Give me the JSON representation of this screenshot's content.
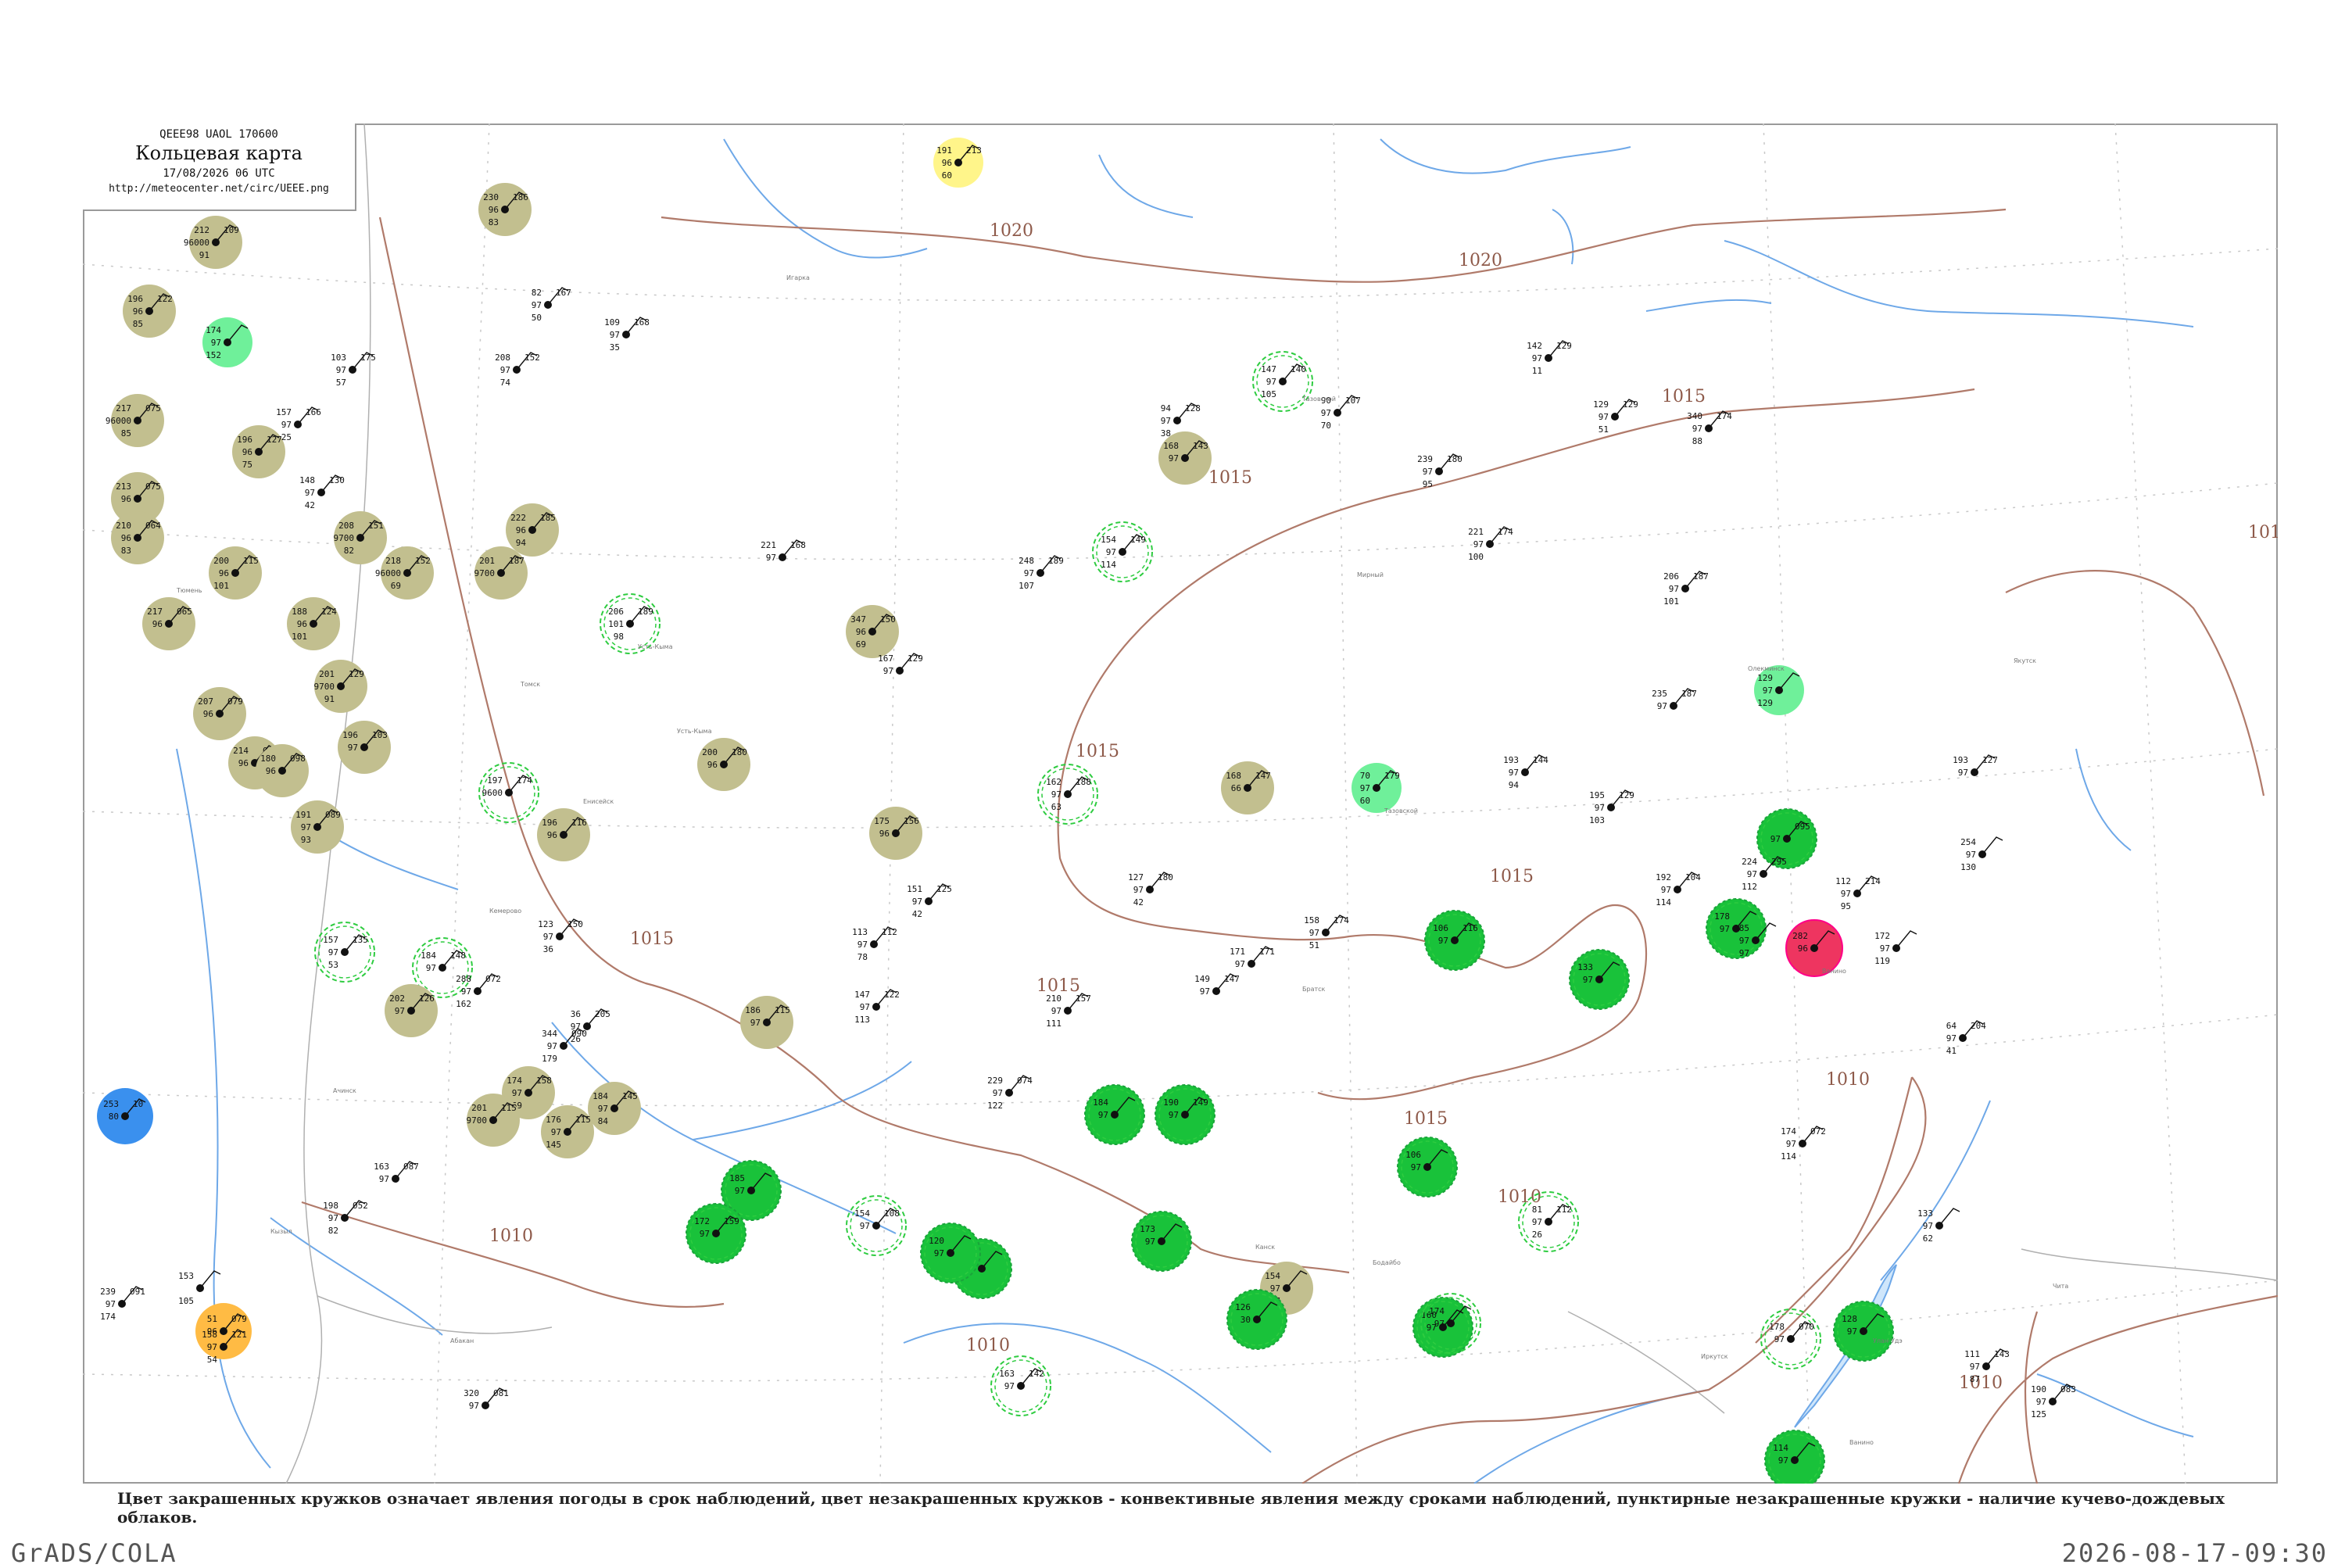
{
  "header": {
    "code": "QEEE98  UAOL  170600",
    "title": "Кольцевая карта",
    "datetime": "17/08/2026 06 UTC",
    "url": "http://meteocenter.net/circ/UEEE.png"
  },
  "caption": "Цвет закрашенных кружков означает явления погоды в срок наблюдений, цвет незакрашенных кружков - конвективные явления между сроками наблюдений, пунктирные незакрашенные кружки - наличие кучево-дождевых облаков.",
  "footer": {
    "left": "GrADS/COLA",
    "right": "2026-08-17-09:30"
  },
  "colors": {
    "isobar": "#b07a6a",
    "river": "#6ea8e8",
    "boundary": "#b0b0b0",
    "olive": "#c2bf8f",
    "green": "#19c23a",
    "light_green": "#6ff09a",
    "yellow": "#fff58a",
    "orange": "#ffbb44",
    "blue": "#3a90ee",
    "red": "#ee3560",
    "dashed_green": "#2ecc40"
  },
  "isobars": [
    {
      "label": "1020"
    },
    {
      "label": "1020"
    },
    {
      "label": "1015"
    },
    {
      "label": "1015"
    },
    {
      "label": "1015"
    },
    {
      "label": "1015"
    },
    {
      "label": "1015"
    },
    {
      "label": "1015"
    },
    {
      "label": "1015"
    },
    {
      "label": "1010"
    },
    {
      "label": "1010"
    },
    {
      "label": "1010"
    },
    {
      "label": "1010"
    },
    {
      "label": "1010"
    },
    {
      "label": "101"
    }
  ],
  "stations": [
    {
      "p": "191",
      "t": "96",
      "dt": "60",
      "c": "213",
      "name": "",
      "style": "yellow"
    },
    {
      "p": "230",
      "t": "96",
      "dt": "83",
      "c": "186",
      "name": "",
      "style": "olive"
    },
    {
      "p": "212",
      "t": "96000",
      "dt": "91",
      "c": "109",
      "name": "",
      "style": "olive"
    },
    {
      "p": "196",
      "t": "96",
      "dt": "85",
      "c": "122",
      "name": "",
      "style": "olive"
    },
    {
      "p": "174",
      "t": "97",
      "dt": "152",
      "c": "",
      "name": "",
      "style": "light_green"
    },
    {
      "p": "217",
      "t": "96000",
      "dt": "85",
      "c": "075",
      "name": "",
      "style": "olive"
    },
    {
      "p": "196",
      "t": "96",
      "dt": "75",
      "c": "127",
      "name": "",
      "style": "olive"
    },
    {
      "p": "213",
      "t": "96",
      "dt": "",
      "c": "075",
      "name": "",
      "style": "olive"
    },
    {
      "p": "210",
      "t": "96",
      "dt": "83",
      "c": "064",
      "name": "",
      "style": "olive"
    },
    {
      "p": "208",
      "t": "9700",
      "dt": "82",
      "c": "151",
      "name": "",
      "style": "olive"
    },
    {
      "p": "222",
      "t": "96",
      "dt": "94",
      "c": "185",
      "name": "",
      "style": "olive"
    },
    {
      "p": "218",
      "t": "96000",
      "dt": "69",
      "c": "152",
      "name": "",
      "style": "olive"
    },
    {
      "p": "200",
      "t": "96",
      "dt": "101",
      "c": "115",
      "name": "",
      "style": "olive"
    },
    {
      "p": "201",
      "t": "9700",
      "dt": "",
      "c": "187",
      "name": "",
      "style": "olive"
    },
    {
      "p": "188",
      "t": "96",
      "dt": "101",
      "c": "124",
      "name": "",
      "style": "olive"
    },
    {
      "p": "217",
      "t": "96",
      "dt": "",
      "c": "065",
      "name": "",
      "style": "olive"
    },
    {
      "p": "347",
      "t": "96",
      "dt": "69",
      "c": "150",
      "name": "",
      "style": "olive"
    },
    {
      "p": "206",
      "t": "101",
      "dt": "98",
      "c": "189",
      "name": "Усть-Кыма",
      "style": "dashed"
    },
    {
      "p": "201",
      "t": "9700",
      "dt": "91",
      "c": "129",
      "name": "",
      "style": "olive"
    },
    {
      "p": "207",
      "t": "96",
      "dt": "",
      "c": "079",
      "name": "",
      "style": "olive"
    },
    {
      "p": "214",
      "t": "96",
      "dt": "",
      "c": "093",
      "name": "",
      "style": "olive"
    },
    {
      "p": "196",
      "t": "97",
      "dt": "",
      "c": "103",
      "name": "",
      "style": "olive"
    },
    {
      "p": "180",
      "t": "96",
      "dt": "",
      "c": "098",
      "name": "",
      "style": "olive"
    },
    {
      "p": "200",
      "t": "96",
      "dt": "",
      "c": "180",
      "name": "",
      "style": "olive"
    },
    {
      "p": "197",
      "t": "9600",
      "dt": "",
      "c": "174",
      "name": "",
      "style": "dashed"
    },
    {
      "p": "191",
      "t": "97",
      "dt": "93",
      "c": "089",
      "name": "",
      "style": "olive"
    },
    {
      "p": "196",
      "t": "96",
      "dt": "",
      "c": "116",
      "name": "",
      "style": "olive"
    },
    {
      "p": "175",
      "t": "96",
      "dt": "",
      "c": "156",
      "name": "",
      "style": "olive"
    },
    {
      "p": "162",
      "t": "97",
      "dt": "63",
      "c": "188",
      "name": "",
      "style": "dashed"
    },
    {
      "p": "168",
      "t": "66",
      "dt": "",
      "c": "147",
      "name": "",
      "style": "olive"
    },
    {
      "p": "168",
      "t": "97",
      "dt": "",
      "c": "143",
      "name": "",
      "style": "olive"
    },
    {
      "p": "154",
      "t": "97",
      "dt": "114",
      "c": "149",
      "name": "",
      "style": "dashed"
    },
    {
      "p": "147",
      "t": "97",
      "dt": "105",
      "c": "140",
      "name": "",
      "style": "dashed"
    },
    {
      "p": "70",
      "t": "97",
      "dt": "60",
      "c": "179",
      "name": "Тазовской",
      "style": "light_green"
    },
    {
      "p": "157",
      "t": "97",
      "dt": "53",
      "c": "135",
      "name": "",
      "style": "dashed"
    },
    {
      "p": "184",
      "t": "97",
      "dt": "",
      "c": "148",
      "name": "",
      "style": "dashed"
    },
    {
      "p": "202",
      "t": "97",
      "dt": "",
      "c": "126",
      "name": "",
      "style": "olive"
    },
    {
      "p": "186",
      "t": "97",
      "dt": "",
      "c": "115",
      "name": "",
      "style": "olive"
    },
    {
      "p": "174",
      "t": "97",
      "dt": "69",
      "c": "158",
      "name": "",
      "style": "olive"
    },
    {
      "p": "184",
      "t": "97",
      "dt": "84",
      "c": "145",
      "name": "",
      "style": "olive"
    },
    {
      "p": "201",
      "t": "9700",
      "dt": "",
      "c": "115",
      "name": "",
      "style": "olive"
    },
    {
      "p": "176",
      "t": "97",
      "dt": "145",
      "c": "115",
      "name": "",
      "style": "olive"
    },
    {
      "p": "253",
      "t": "80",
      "dt": "",
      "c": "10",
      "name": "",
      "style": "blue"
    },
    {
      "p": "51",
      "t": "96",
      "dt": "",
      "c": "079",
      "name": "",
      "style": "orange"
    },
    {
      "p": "185",
      "t": "97",
      "dt": "",
      "c": "",
      "name": "",
      "style": "green"
    },
    {
      "p": "172",
      "t": "97",
      "dt": "",
      "c": "159",
      "name": "",
      "style": "green"
    },
    {
      "p": "154",
      "t": "97",
      "dt": "",
      "c": "108",
      "name": "",
      "style": "dashed"
    },
    {
      "p": "184",
      "t": "97",
      "dt": "",
      "c": "",
      "name": "",
      "style": "green"
    },
    {
      "p": "175",
      "t": "97",
      "dt": "",
      "c": "",
      "name": "",
      "style": "green"
    },
    {
      "p": "163",
      "t": "97",
      "dt": "",
      "c": "142",
      "name": "",
      "style": "dashed"
    },
    {
      "p": "120",
      "t": "97",
      "dt": "",
      "c": "",
      "name": "",
      "style": "green"
    },
    {
      "p": "190",
      "t": "97",
      "dt": "",
      "c": "149",
      "name": "",
      "style": "green"
    },
    {
      "p": "173",
      "t": "97",
      "dt": "",
      "c": "",
      "name": "",
      "style": "green"
    },
    {
      "p": "154",
      "t": "97",
      "dt": "67",
      "c": "",
      "name": "",
      "style": "olive"
    },
    {
      "p": "126",
      "t": "30",
      "dt": "",
      "c": "",
      "name": "",
      "style": "green"
    },
    {
      "p": "106",
      "t": "97",
      "dt": "",
      "c": "",
      "name": "",
      "style": "green"
    },
    {
      "p": "106",
      "t": "97",
      "dt": "",
      "c": "116",
      "name": "",
      "style": "green"
    },
    {
      "p": "160",
      "t": "97",
      "dt": "",
      "c": "",
      "name": "",
      "style": "green"
    },
    {
      "p": "174",
      "t": "97",
      "dt": "",
      "c": "",
      "name": "",
      "style": "dashed"
    },
    {
      "p": "81",
      "t": "97",
      "dt": "26",
      "c": "112",
      "name": "",
      "style": "dashed"
    },
    {
      "p": "133",
      "t": "97",
      "dt": "",
      "c": "",
      "name": "",
      "style": "green"
    },
    {
      "p": "178",
      "t": "97",
      "dt": "",
      "c": "",
      "name": "",
      "style": "green"
    },
    {
      "p": "129",
      "t": "97",
      "dt": "129",
      "c": "",
      "name": "",
      "style": "light_green"
    },
    {
      "p": "",
      "t": "97",
      "dt": "",
      "c": "095",
      "name": "",
      "style": "green"
    },
    {
      "p": "282",
      "t": "96",
      "dt": "",
      "c": "",
      "name": "Ванино",
      "style": "red"
    },
    {
      "p": "174",
      "t": "97",
      "dt": "114",
      "c": "072",
      "name": "",
      "style": "plain"
    },
    {
      "p": "178",
      "t": "97",
      "dt": "",
      "c": "070",
      "name": "",
      "style": "dashed"
    },
    {
      "p": "128",
      "t": "97",
      "dt": "",
      "c": "",
      "name": "",
      "style": "green"
    },
    {
      "p": "114",
      "t": "97",
      "dt": "",
      "c": "",
      "name": "",
      "style": "green"
    },
    {
      "p": "193",
      "t": "97",
      "dt": "",
      "c": "127",
      "name": "",
      "style": "plain"
    },
    {
      "p": "254",
      "t": "97",
      "dt": "130",
      "c": "",
      "name": "",
      "style": "plain"
    },
    {
      "p": "224",
      "t": "97",
      "dt": "112",
      "c": "295",
      "name": "",
      "style": "plain"
    },
    {
      "p": "112",
      "t": "97",
      "dt": "95",
      "c": "214",
      "name": "",
      "style": "plain"
    },
    {
      "p": "64",
      "t": "97",
      "dt": "41",
      "c": "204",
      "name": "",
      "style": "plain"
    },
    {
      "p": "36",
      "t": "97",
      "dt": "26",
      "c": "205",
      "name": "",
      "style": "plain"
    },
    {
      "p": "82",
      "t": "97",
      "dt": "50",
      "c": "167",
      "name": "",
      "style": "plain"
    },
    {
      "p": "109",
      "t": "97",
      "dt": "35",
      "c": "168",
      "name": "",
      "style": "plain"
    },
    {
      "p": "94",
      "t": "97",
      "dt": "38",
      "c": "128",
      "name": "",
      "style": "plain"
    },
    {
      "p": "90",
      "t": "97",
      "dt": "70",
      "c": "107",
      "name": "",
      "style": "plain"
    },
    {
      "p": "142",
      "t": "97",
      "dt": "11",
      "c": "129",
      "name": "",
      "style": "plain"
    },
    {
      "p": "129",
      "t": "97",
      "dt": "51",
      "c": "129",
      "name": "",
      "style": "plain"
    },
    {
      "p": "340",
      "t": "97",
      "dt": "88",
      "c": "174",
      "name": "",
      "style": "plain"
    },
    {
      "p": "206",
      "t": "97",
      "dt": "101",
      "c": "187",
      "name": "",
      "style": "plain"
    },
    {
      "p": "235",
      "t": "97",
      "dt": "",
      "c": "187",
      "name": "",
      "style": "plain"
    },
    {
      "p": "239",
      "t": "97",
      "dt": "95",
      "c": "180",
      "name": "",
      "style": "plain"
    },
    {
      "p": "221",
      "t": "97",
      "dt": "100",
      "c": "174",
      "name": "",
      "style": "plain"
    },
    {
      "p": "248",
      "t": "97",
      "dt": "107",
      "c": "189",
      "name": "",
      "style": "plain"
    },
    {
      "p": "221",
      "t": "97",
      "dt": "",
      "c": "168",
      "name": "",
      "style": "plain"
    },
    {
      "p": "208",
      "t": "97",
      "dt": "74",
      "c": "152",
      "name": "",
      "style": "plain"
    },
    {
      "p": "103",
      "t": "97",
      "dt": "57",
      "c": "175",
      "name": "",
      "style": "plain"
    },
    {
      "p": "157",
      "t": "97",
      "dt": "25",
      "c": "166",
      "name": "",
      "style": "plain"
    },
    {
      "p": "148",
      "t": "97",
      "dt": "42",
      "c": "130",
      "name": "",
      "style": "plain"
    },
    {
      "p": "123",
      "t": "97",
      "dt": "36",
      "c": "150",
      "name": "",
      "style": "plain"
    },
    {
      "p": "167",
      "t": "97",
      "dt": "",
      "c": "129",
      "name": "",
      "style": "plain"
    },
    {
      "p": "151",
      "t": "97",
      "dt": "42",
      "c": "125",
      "name": "",
      "style": "plain"
    },
    {
      "p": "113",
      "t": "97",
      "dt": "78",
      "c": "112",
      "name": "",
      "style": "plain"
    },
    {
      "p": "127",
      "t": "97",
      "dt": "42",
      "c": "180",
      "name": "",
      "style": "plain"
    },
    {
      "p": "158",
      "t": "97",
      "dt": "51",
      "c": "174",
      "name": "",
      "style": "plain"
    },
    {
      "p": "171",
      "t": "97",
      "dt": "",
      "c": "171",
      "name": "",
      "style": "plain"
    },
    {
      "p": "193",
      "t": "97",
      "dt": "94",
      "c": "144",
      "name": "",
      "style": "plain"
    },
    {
      "p": "195",
      "t": "97",
      "dt": "103",
      "c": "129",
      "name": "",
      "style": "plain"
    },
    {
      "p": "192",
      "t": "97",
      "dt": "114",
      "c": "104",
      "name": "",
      "style": "plain"
    },
    {
      "p": "185",
      "t": "97",
      "dt": "97",
      "c": "",
      "name": "",
      "style": "plain"
    },
    {
      "p": "172",
      "t": "97",
      "dt": "119",
      "c": "",
      "name": "",
      "style": "plain"
    },
    {
      "p": "149",
      "t": "97",
      "dt": "",
      "c": "147",
      "name": "",
      "style": "plain"
    },
    {
      "p": "210",
      "t": "97",
      "dt": "111",
      "c": "157",
      "name": "",
      "style": "plain"
    },
    {
      "p": "147",
      "t": "97",
      "dt": "113",
      "c": "122",
      "name": "",
      "style": "plain"
    },
    {
      "p": "288",
      "t": "97",
      "dt": "162",
      "c": "072",
      "name": "",
      "style": "plain"
    },
    {
      "p": "344",
      "t": "97",
      "dt": "179",
      "c": "090",
      "name": "",
      "style": "plain"
    },
    {
      "p": "229",
      "t": "97",
      "dt": "122",
      "c": "074",
      "name": "",
      "style": "plain"
    },
    {
      "p": "163",
      "t": "97",
      "dt": "",
      "c": "087",
      "name": "",
      "style": "plain"
    },
    {
      "p": "198",
      "t": "97",
      "dt": "82",
      "c": "052",
      "name": "",
      "style": "plain"
    },
    {
      "p": "133",
      "t": "97",
      "dt": "62",
      "c": "",
      "name": "",
      "style": "plain"
    },
    {
      "p": "111",
      "t": "97",
      "dt": "87",
      "c": "143",
      "name": "",
      "style": "plain"
    },
    {
      "p": "190",
      "t": "97",
      "dt": "125",
      "c": "083",
      "name": "",
      "style": "plain"
    },
    {
      "p": "320",
      "t": "97",
      "dt": "",
      "c": "081",
      "name": "",
      "style": "plain"
    },
    {
      "p": "239",
      "t": "97",
      "dt": "174",
      "c": "091",
      "name": "",
      "style": "plain"
    },
    {
      "p": "153",
      "t": "",
      "dt": "105",
      "c": "",
      "name": "",
      "style": "plain"
    },
    {
      "p": "158",
      "t": "97",
      "dt": "54",
      "c": "121",
      "name": "",
      "style": "plain"
    }
  ],
  "place_names": [
    "Тазовской",
    "Усть-Кыма",
    "Ванино",
    "Ачинск",
    "Енисейск",
    "Кызыл",
    "Тюмень",
    "Томск",
    "Чита",
    "Улан-Удэ",
    "Братск",
    "Игарка",
    "Мирный",
    "Якутск",
    "Олекминск",
    "Бодайбо",
    "Канск",
    "Иркутск",
    "Кемерово",
    "Абакан"
  ]
}
